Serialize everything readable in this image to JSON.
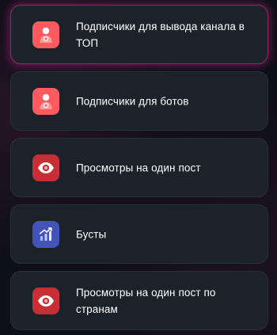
{
  "items": [
    {
      "label": "Подписчики для вывода канала в ТОП",
      "icon": "user-plus-icon",
      "icon_color": "#ff5a5f",
      "active": true
    },
    {
      "label": "Подписчики для ботов",
      "icon": "user-plus-icon",
      "icon_color": "#ff5a5f",
      "active": false
    },
    {
      "label": "Просмотры на один пост",
      "icon": "eye-icon",
      "icon_color": "#c62f35",
      "active": false
    },
    {
      "label": "Бусты",
      "icon": "chart-up-icon",
      "icon_color": "#4353b8",
      "active": false
    },
    {
      "label": "Просмотры на один пост по странам",
      "icon": "eye-icon",
      "icon_color": "#c62f35",
      "active": false
    }
  ],
  "colors": {
    "background": "#0f0f17",
    "card": "#1c2229",
    "card_border": "#2a3039",
    "active_glow": "#be288c",
    "text": "#ffffff"
  }
}
